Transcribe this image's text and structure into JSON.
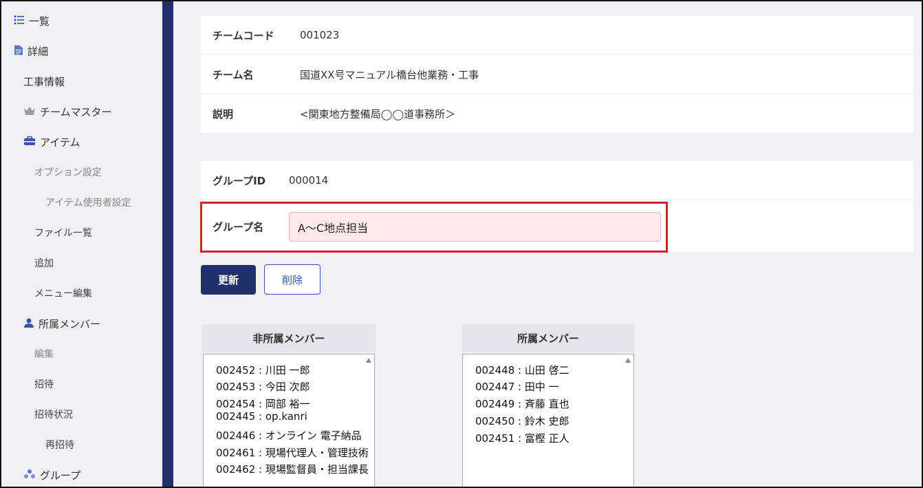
{
  "sidebar": {
    "items": [
      {
        "label": "一覧",
        "icon": "list-icon"
      },
      {
        "label": "詳細",
        "icon": "document-icon"
      },
      {
        "label": "工事情報"
      },
      {
        "label": "チームマスター",
        "icon": "crown-icon"
      },
      {
        "label": "アイテム",
        "icon": "toolbox-icon"
      },
      {
        "label": "オプション設定"
      },
      {
        "label": "アイテム使用者設定"
      },
      {
        "label": "ファイル一覧"
      },
      {
        "label": "追加"
      },
      {
        "label": "メニュー編集"
      },
      {
        "label": "所属メンバー",
        "icon": "user-icon"
      },
      {
        "label": "編集"
      },
      {
        "label": "招待"
      },
      {
        "label": "招待状況"
      },
      {
        "label": "再招待"
      },
      {
        "label": "グループ",
        "icon": "group-icon"
      }
    ]
  },
  "team": {
    "code_label": "チームコード",
    "code_value": "001023",
    "name_label": "チーム名",
    "name_value": "国道XX号マニュアル橋台他業務・工事",
    "desc_label": "説明",
    "desc_value": "<関東地方整備局◯◯道事務所＞"
  },
  "group": {
    "id_label": "グループID",
    "id_value": "000014",
    "name_label": "グループ名",
    "name_value": "A〜C地点担当"
  },
  "actions": {
    "update_label": "更新",
    "delete_label": "削除"
  },
  "non_members": {
    "header": "非所属メンバー",
    "items": [
      "002452 : 川田 一郎",
      "002453 : 今田 次郎",
      "002454 : 岡部 裕一",
      "002445 : op.kanri",
      "002446 : オンライン 電子納品",
      "002461 : 現場代理人・管理技術",
      "002462 : 現場監督員・担当課長"
    ]
  },
  "members": {
    "header": "所属メンバー",
    "items": [
      "002448 : 山田 啓二",
      "002447 : 田中 一",
      "002449 : 斉藤 直也",
      "002450 : 鈴木 史郎",
      "002451 : 富樫 正人"
    ]
  },
  "colors": {
    "navy": "#22316b",
    "highlight_red": "#d62424",
    "input_pink": "#fde8ea"
  }
}
